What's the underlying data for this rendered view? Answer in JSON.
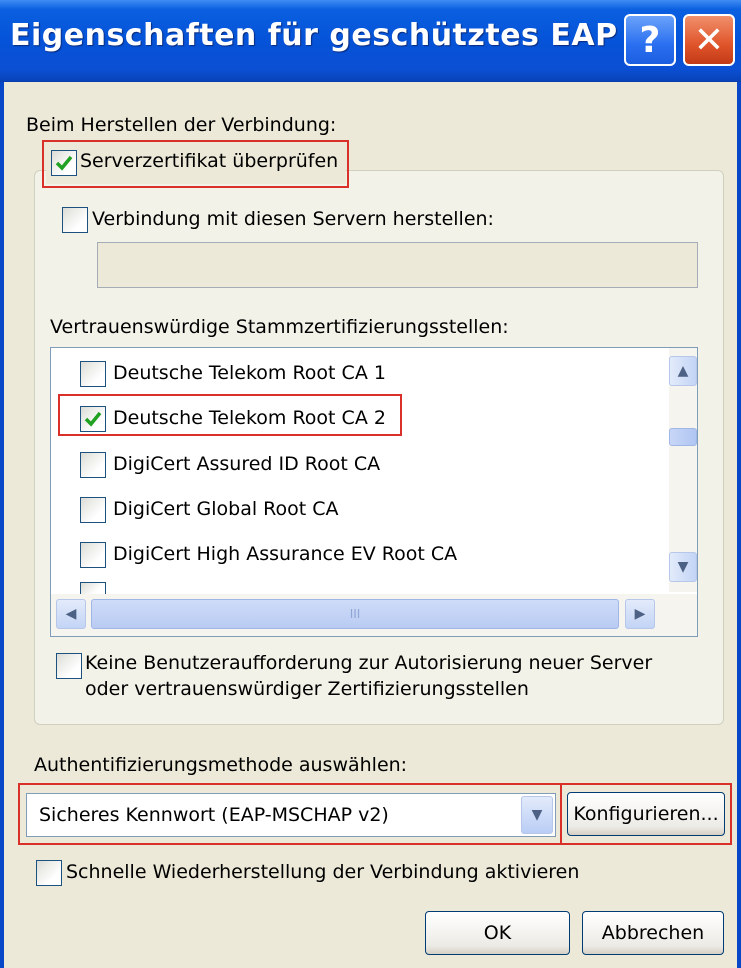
{
  "window": {
    "title": "Eigenschaften für geschütztes EAP"
  },
  "titlebar": {
    "help_glyph": "?",
    "close_glyph": "✕",
    "help_icon": "help-icon",
    "close_icon": "close-icon"
  },
  "connection": {
    "section_label": "Beim Herstellen der Verbindung:",
    "verify_server_cert": {
      "label": "Serverzertifikat überprüfen",
      "checked": true
    },
    "connect_to_servers": {
      "label": "Verbindung mit diesen Servern herstellen:",
      "checked": false,
      "value": ""
    },
    "trusted_roots_label": "Vertrauenswürdige Stammzertifizierungsstellen:",
    "trusted_roots": [
      {
        "label": "Deutsche Telekom Root CA 1",
        "checked": false
      },
      {
        "label": "Deutsche Telekom Root CA 2",
        "checked": true
      },
      {
        "label": "DigiCert Assured ID Root CA",
        "checked": false
      },
      {
        "label": "DigiCert Global Root CA",
        "checked": false
      },
      {
        "label": "DigiCert High Assurance EV Root CA",
        "checked": false
      }
    ],
    "no_prompt": {
      "line1": "Keine Benutzeraufforderung zur Autorisierung neuer Server",
      "line2": "oder vertrauenswürdiger Zertifizierungsstellen",
      "checked": false
    }
  },
  "auth": {
    "label": "Authentifizierungsmethode auswählen:",
    "selected": "Sicheres Kennwort (EAP-MSCHAP v2)",
    "configure_label": "Konfigurieren..."
  },
  "fast_reconnect": {
    "label": "Schnelle Wiederherstellung der Verbindung aktivieren",
    "checked": false
  },
  "buttons": {
    "ok": "OK",
    "cancel": "Abbrechen"
  },
  "scroll": {
    "hthumb_grip": "III"
  },
  "colors": {
    "title_blue": "#0553d8",
    "highlight_red": "#d9302a",
    "check_green": "#21a121"
  }
}
